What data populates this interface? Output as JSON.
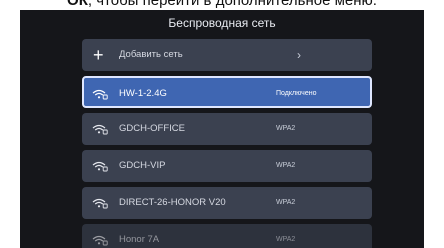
{
  "caption": {
    "bold": "ОК",
    "text": ", чтобы перейти в дополнительное меню."
  },
  "screen": {
    "title": "Беспроводная сеть",
    "add_network": {
      "icon": "plus-icon",
      "label": "Добавить сеть",
      "chevron": "›"
    },
    "networks": [
      {
        "ssid": "HW-1-2.4G",
        "status": "Подключено",
        "icon": "wifi-lock-icon",
        "selected": true
      },
      {
        "ssid": "GDCH-OFFICE",
        "status": "WPA2",
        "icon": "wifi-lock-icon",
        "selected": false
      },
      {
        "ssid": "GDCH-VIP",
        "status": "WPA2",
        "icon": "wifi-lock-icon",
        "selected": false
      },
      {
        "ssid": "DIRECT-26-HONOR V20",
        "status": "WPA2",
        "icon": "wifi-lock-icon",
        "selected": false
      },
      {
        "ssid": "Honor 7A",
        "status": "WPA2",
        "icon": "wifi-lock-icon",
        "selected": false
      }
    ]
  },
  "colors": {
    "screen_bg": "#15161a",
    "row_bg": "#3b4150",
    "selected_bg": "#3f66b2",
    "selected_border": "#dfe7ff"
  }
}
